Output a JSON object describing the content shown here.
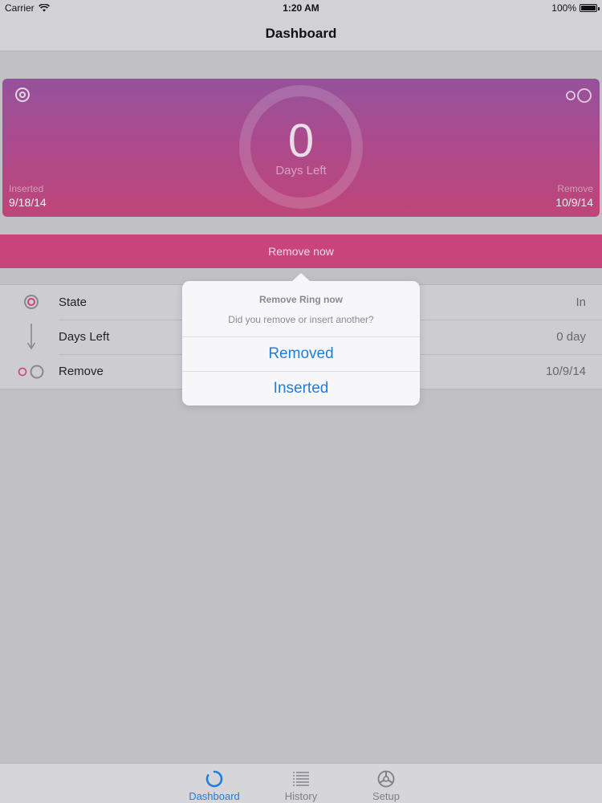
{
  "status_bar": {
    "carrier": "Carrier",
    "time": "1:20 AM",
    "battery": "100%"
  },
  "nav": {
    "title": "Dashboard"
  },
  "hero": {
    "count": "0",
    "count_label": "Days Left",
    "inserted_label": "Inserted",
    "inserted_date": "9/18/14",
    "remove_label": "Remove",
    "remove_date": "10/9/14",
    "gradient_top": "#9a4c9f",
    "gradient_bottom": "#c83e78"
  },
  "remove_now": {
    "label": "Remove now",
    "color": "#d53d7b"
  },
  "info_rows": [
    {
      "icon": "ring-state-icon",
      "label": "State",
      "value": "In"
    },
    {
      "icon": "down-arrow-icon",
      "label": "Days Left",
      "value": "0 day"
    },
    {
      "icon": "two-rings-icon",
      "label": "Remove",
      "value": "10/9/14"
    }
  ],
  "popover": {
    "title": "Remove Ring now",
    "message": "Did you remove or insert another?",
    "buttons": [
      "Removed",
      "Inserted"
    ],
    "accent": "#1c7fe0"
  },
  "tabs": [
    {
      "label": "Dashboard",
      "icon": "dashboard-ring-icon",
      "active": true
    },
    {
      "label": "History",
      "icon": "list-icon",
      "active": false
    },
    {
      "label": "Setup",
      "icon": "gear-wheel-icon",
      "active": false
    }
  ]
}
